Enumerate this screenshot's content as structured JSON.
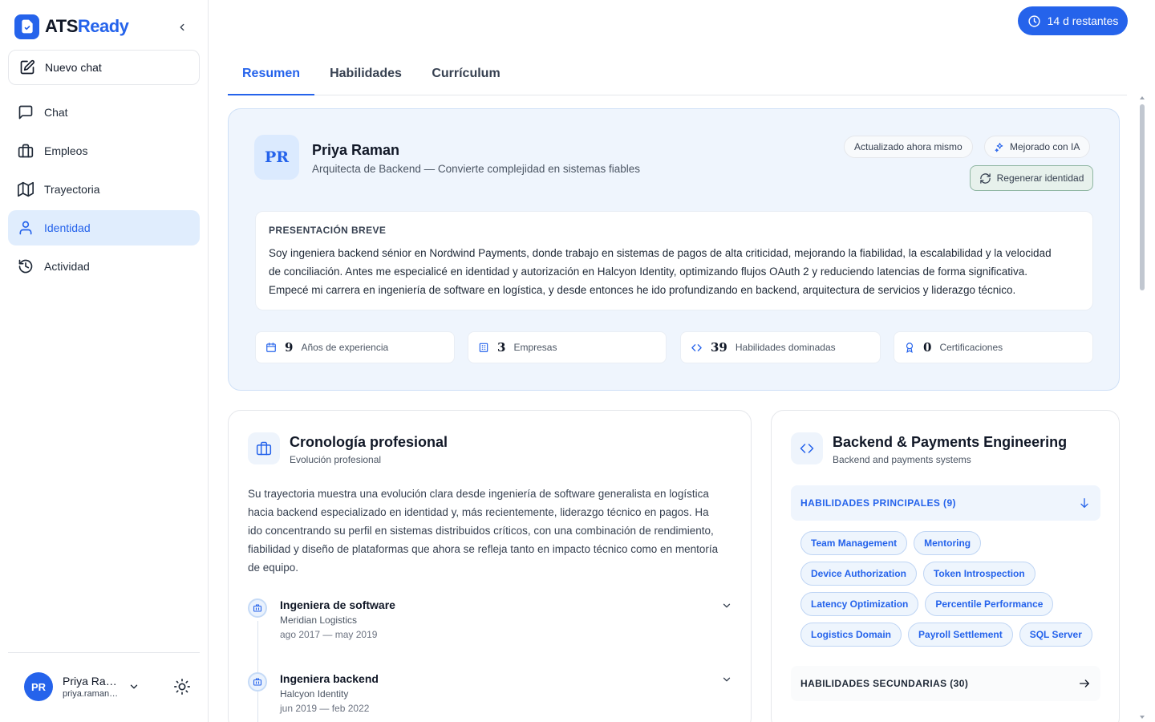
{
  "brand": {
    "part1": "ATS",
    "part2": "Ready",
    "logo_icon": "file-check-icon"
  },
  "sidebar": {
    "new_chat": {
      "label": "Nuevo chat",
      "icon": "edit-icon"
    },
    "items": [
      {
        "label": "Chat",
        "icon": "message-icon",
        "active": false
      },
      {
        "label": "Empleos",
        "icon": "briefcase-icon",
        "active": false
      },
      {
        "label": "Trayectoria",
        "icon": "map-icon",
        "active": false
      },
      {
        "label": "Identidad",
        "icon": "user-icon",
        "active": true
      },
      {
        "label": "Actividad",
        "icon": "history-icon",
        "active": false
      }
    ],
    "user": {
      "initials": "PR",
      "name": "Priya Ram...",
      "email": "priya.raman@..."
    }
  },
  "trial": {
    "label": "14 d restantes",
    "icon": "clock-icon"
  },
  "tabs": [
    {
      "label": "Resumen",
      "active": true
    },
    {
      "label": "Habilidades",
      "active": false
    },
    {
      "label": "Currículum",
      "active": false
    }
  ],
  "profile": {
    "initials": "PR",
    "name": "Priya Raman",
    "tagline": "Arquitecta de Backend — Convierte complejidad en sistemas fiables",
    "updated_label": "Actualizado ahora mismo",
    "ai_label": "Mejorado con IA",
    "regenerate_label": "Regenerar identidad",
    "bio_heading": "PRESENTACIÓN BREVE",
    "bio_lines": [
      "Soy ingeniera backend sénior en Nordwind Payments, donde trabajo en sistemas de pagos de alta criticidad, mejorando la fiabilidad, la escalabilidad y la velocidad",
      "de conciliación. Antes me especialicé en identidad y autorización en Halcyon Identity, optimizando flujos OAuth 2 y reduciendo latencias de forma significativa.",
      "Empecé mi carrera en ingeniería de software en logística, y desde entonces he ido profundizando en backend, arquitectura de servicios y liderazgo técnico."
    ],
    "stats": [
      {
        "value": "9",
        "label": "Años de experiencia",
        "icon": "calendar-icon"
      },
      {
        "value": "3",
        "label": "Empresas",
        "icon": "building-icon"
      },
      {
        "value": "39",
        "label": "Habilidades dominadas",
        "icon": "code-icon"
      },
      {
        "value": "0",
        "label": "Certificaciones",
        "icon": "award-icon"
      }
    ]
  },
  "career": {
    "title": "Cronología profesional",
    "subtitle": "Evolución profesional",
    "summary_lines": [
      "Su trayectoria muestra una evolución clara desde ingeniería de software generalista en logística",
      "hacia backend especializado en identidad y, más recientemente, liderazgo técnico en pagos. Ha",
      "ido concentrando su perfil en sistemas distribuidos críticos, con una combinación de rendimiento,",
      "fiabilidad y diseño de plataformas que ahora se refleja tanto en impacto técnico como en mentoría",
      "de equipo."
    ],
    "timeline": [
      {
        "role": "Ingeniera de software",
        "company": "Meridian Logistics",
        "dates": "ago 2017 — may 2019"
      },
      {
        "role": "Ingeniera backend",
        "company": "Halcyon Identity",
        "dates": "jun 2019 — feb 2022"
      }
    ]
  },
  "skills": {
    "title": "Backend & Payments Engineering",
    "subtitle": "Backend and payments systems",
    "primary_label": "HABILIDADES PRINCIPALES (9)",
    "primary_rows": [
      [
        "Team Management",
        "Mentoring"
      ],
      [
        "Device Authorization",
        "Token Introspection"
      ],
      [
        "Latency Optimization",
        "Percentile Performance"
      ],
      [
        "Logistics Domain",
        "Payroll Settlement",
        "SQL Server"
      ]
    ],
    "secondary_label": "HABILIDADES SECUNDARIAS (30)"
  },
  "colors": {
    "accent": "#2563eb",
    "active_nav_bg": "#e0edfd",
    "hero_bg": "#eff5fd",
    "regen_border": "#8fb6a2"
  }
}
